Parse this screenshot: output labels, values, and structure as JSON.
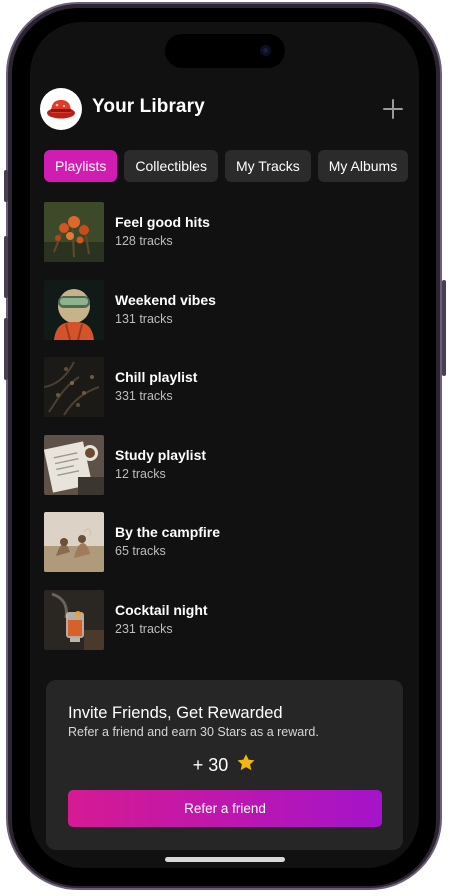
{
  "header": {
    "title": "Your Library",
    "avatar_icon": "red-bucket-hat-icon",
    "add_icon": "plus-icon"
  },
  "tabs": [
    {
      "label": "Playlists",
      "active": true
    },
    {
      "label": "Collectibles",
      "active": false
    },
    {
      "label": "My Tracks",
      "active": false
    },
    {
      "label": "My Albums",
      "active": false
    }
  ],
  "playlists": [
    {
      "title": "Feel good hits",
      "tracks": "128 tracks"
    },
    {
      "title": "Weekend vibes",
      "tracks": "131 tracks"
    },
    {
      "title": "Chill playlist",
      "tracks": "331 tracks"
    },
    {
      "title": "Study playlist",
      "tracks": "12 tracks"
    },
    {
      "title": "By the campfire",
      "tracks": "65 tracks"
    },
    {
      "title": "Cocktail night",
      "tracks": "231 tracks"
    }
  ],
  "invite": {
    "title": "Invite Friends, Get Rewarded",
    "subtitle": "Refer a friend and earn 30 Stars as a reward.",
    "reward": "+ 30",
    "reward_icon": "star-icon",
    "button_label": "Refer a friend"
  },
  "colors": {
    "accent": "#d01cb0",
    "background": "#111111",
    "card": "#262626",
    "button_gradient_start": "#d61a92",
    "button_gradient_end": "#a414c9",
    "star": "#f5b50a"
  }
}
